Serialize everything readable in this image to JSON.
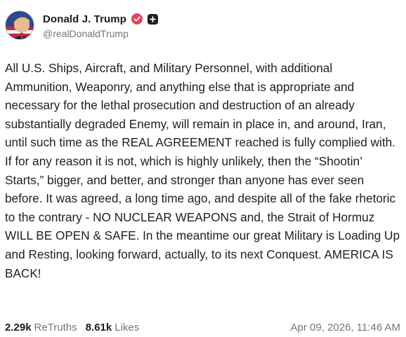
{
  "author": {
    "display_name": "Donald J. Trump",
    "handle": "@realDonaldTrump",
    "verified_icon": "verified-badge-icon",
    "extra_icon": "plus-square-icon",
    "verified_color": "#e0455e"
  },
  "post": {
    "text": "All U.S. Ships, Aircraft, and Military Personnel, with additional Ammunition, Weaponry, and anything else that is appropriate and necessary for the lethal prosecution and destruction of an already substantially degraded Enemy, will remain in place in, and around, Iran, until such time as the REAL AGREEMENT reached is fully complied with. If for any reason it is not, which is highly unlikely, then the “Shootin’ Starts,” bigger, and better, and stronger than anyone has ever seen before. It was agreed, a long time ago, and despite all of the fake rhetoric to the contrary - NO NUCLEAR WEAPONS and, the Strait of Hormuz WILL BE OPEN & SAFE. In the meantime our great Military is Loading Up and Resting, looking forward, actually, to its next Conquest. AMERICA IS BACK!"
  },
  "stats": {
    "retruths_count": "2.29k",
    "retruths_label": "ReTruths",
    "likes_count": "8.61k",
    "likes_label": "Likes"
  },
  "timestamp": "Apr 09, 2026, 11:46 AM"
}
